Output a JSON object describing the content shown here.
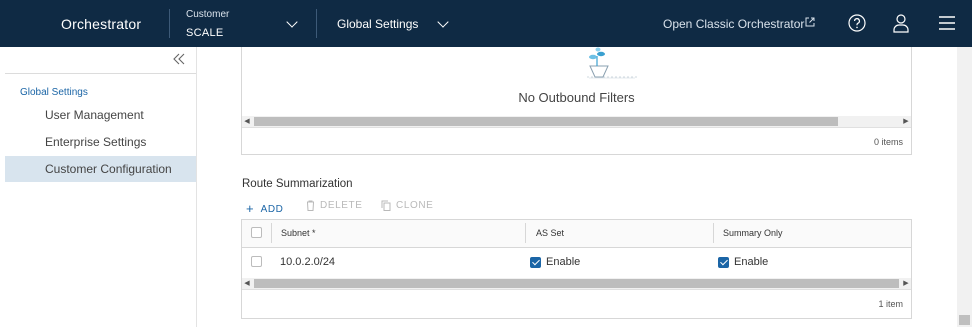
{
  "header": {
    "app_title": "Orchestrator",
    "customer_label": "Customer",
    "customer_value": "SCALE",
    "global_settings": "Global Settings",
    "classic_link": "Open Classic Orchestrator",
    "bg_color": "#0f2a44"
  },
  "sidebar": {
    "group": "Global Settings",
    "items": [
      {
        "label": "User Management",
        "active": false
      },
      {
        "label": "Enterprise Settings",
        "active": false
      },
      {
        "label": "Customer Configuration",
        "active": true
      }
    ]
  },
  "outbound": {
    "empty_text": "No Outbound Filters",
    "count": "0 items"
  },
  "route_summarization": {
    "title": "Route Summarization",
    "actions": {
      "add": "ADD",
      "delete": "DELETE",
      "clone": "CLONE"
    },
    "columns": [
      "Subnet *",
      "AS Set",
      "Summary Only"
    ],
    "rows": [
      {
        "subnet": "10.0.2.0/24",
        "as_set": "Enable",
        "as_set_checked": true,
        "summary_only": "Enable",
        "summary_only_checked": true
      }
    ],
    "count": "1 item"
  },
  "colors": {
    "accent": "#1b65a6",
    "active_bg": "#d8e4ee"
  }
}
